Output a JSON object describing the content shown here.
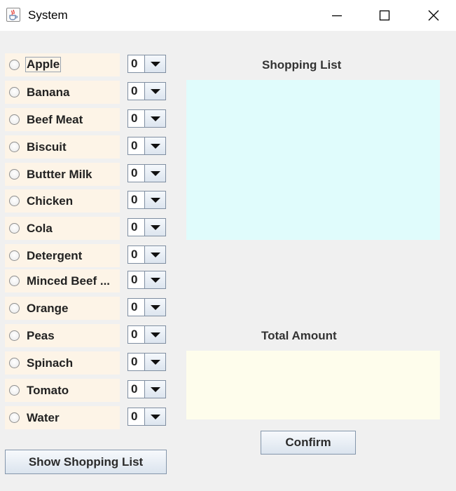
{
  "window": {
    "title": "System",
    "icon": "java-cup-icon",
    "controls": [
      "minimize-icon",
      "maximize-icon",
      "close-icon"
    ]
  },
  "items": [
    {
      "label": "Apple",
      "quantity": "0"
    },
    {
      "label": "Banana",
      "quantity": "0"
    },
    {
      "label": "Beef Meat",
      "quantity": "0"
    },
    {
      "label": "Biscuit",
      "quantity": "0"
    },
    {
      "label": "Buttter Milk",
      "quantity": "0"
    },
    {
      "label": "Chicken",
      "quantity": "0"
    },
    {
      "label": "Cola",
      "quantity": "0"
    },
    {
      "label": "Detergent",
      "quantity": "0"
    },
    {
      "label": "Minced Beef ...",
      "quantity": "0"
    },
    {
      "label": "Orange",
      "quantity": "0"
    },
    {
      "label": "Peas",
      "quantity": "0"
    },
    {
      "label": "Spinach",
      "quantity": "0"
    },
    {
      "label": "Tomato",
      "quantity": "0"
    },
    {
      "label": "Water",
      "quantity": "0"
    }
  ],
  "shopping_list": {
    "label": "Shopping List",
    "content": ""
  },
  "total": {
    "label": "Total Amount",
    "content": ""
  },
  "buttons": {
    "confirm": "Confirm",
    "show_list": "Show Shopping List"
  },
  "colors": {
    "item_background": "#fdf4e7",
    "shopping_list_background": "#e0fcfc",
    "total_background": "#fefdec"
  }
}
